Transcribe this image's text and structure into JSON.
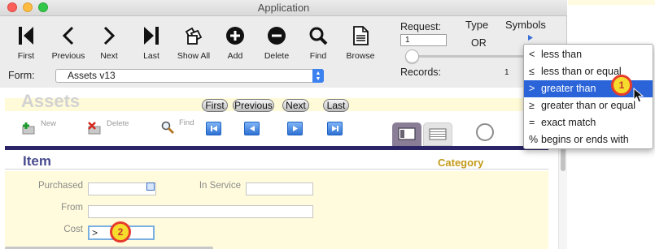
{
  "window": {
    "title": "Application"
  },
  "toolbar": {
    "buttons": [
      {
        "label": "First",
        "icon": "first-icon"
      },
      {
        "label": "Previous",
        "icon": "previous-icon"
      },
      {
        "label": "Next",
        "icon": "next-icon"
      },
      {
        "label": "Last",
        "icon": "last-icon"
      },
      {
        "label": "Show All",
        "icon": "show-all-icon"
      },
      {
        "label": "Add",
        "icon": "add-icon"
      },
      {
        "label": "Delete",
        "icon": "delete-icon"
      },
      {
        "label": "Find",
        "icon": "find-icon"
      },
      {
        "label": "Browse",
        "icon": "browse-icon"
      }
    ]
  },
  "request": {
    "label": "Request:",
    "value": "1"
  },
  "type": {
    "label": "Type",
    "value": "OR"
  },
  "symbols": {
    "label": "Symbols"
  },
  "records": {
    "label": "Records:",
    "count": "1"
  },
  "form": {
    "label": "Form:",
    "value": "Assets v13"
  },
  "layout": {
    "title": "Assets",
    "nav_buttons": [
      "First",
      "Previous",
      "Next",
      "Last"
    ],
    "actions": {
      "new": "New",
      "delete": "Delete",
      "find": "Find"
    },
    "item_heading": "Item",
    "category_heading": "Category",
    "fields": {
      "purchased_label": "Purchased",
      "in_service_label": "In Service",
      "from_label": "From",
      "cost_label": "Cost",
      "cost_value": ">"
    }
  },
  "symbols_menu": {
    "items": [
      {
        "symbol": "<",
        "label": "less than"
      },
      {
        "symbol": "≤",
        "label": "less than or equal"
      },
      {
        "symbol": ">",
        "label": "greater than"
      },
      {
        "symbol": "≥",
        "label": "greater than or equal"
      },
      {
        "symbol": "=",
        "label": "exact match"
      },
      {
        "symbol": "%",
        "label": "begins or ends with"
      }
    ],
    "selected_index": 2
  },
  "callouts": [
    "1",
    "2"
  ],
  "colors": {
    "selection": "#2b64d9",
    "badge_fill": "#f6dc2c",
    "badge_ring": "#e53c2c",
    "item_heading": "#4a4d8e",
    "category_heading": "#c49a1a"
  }
}
